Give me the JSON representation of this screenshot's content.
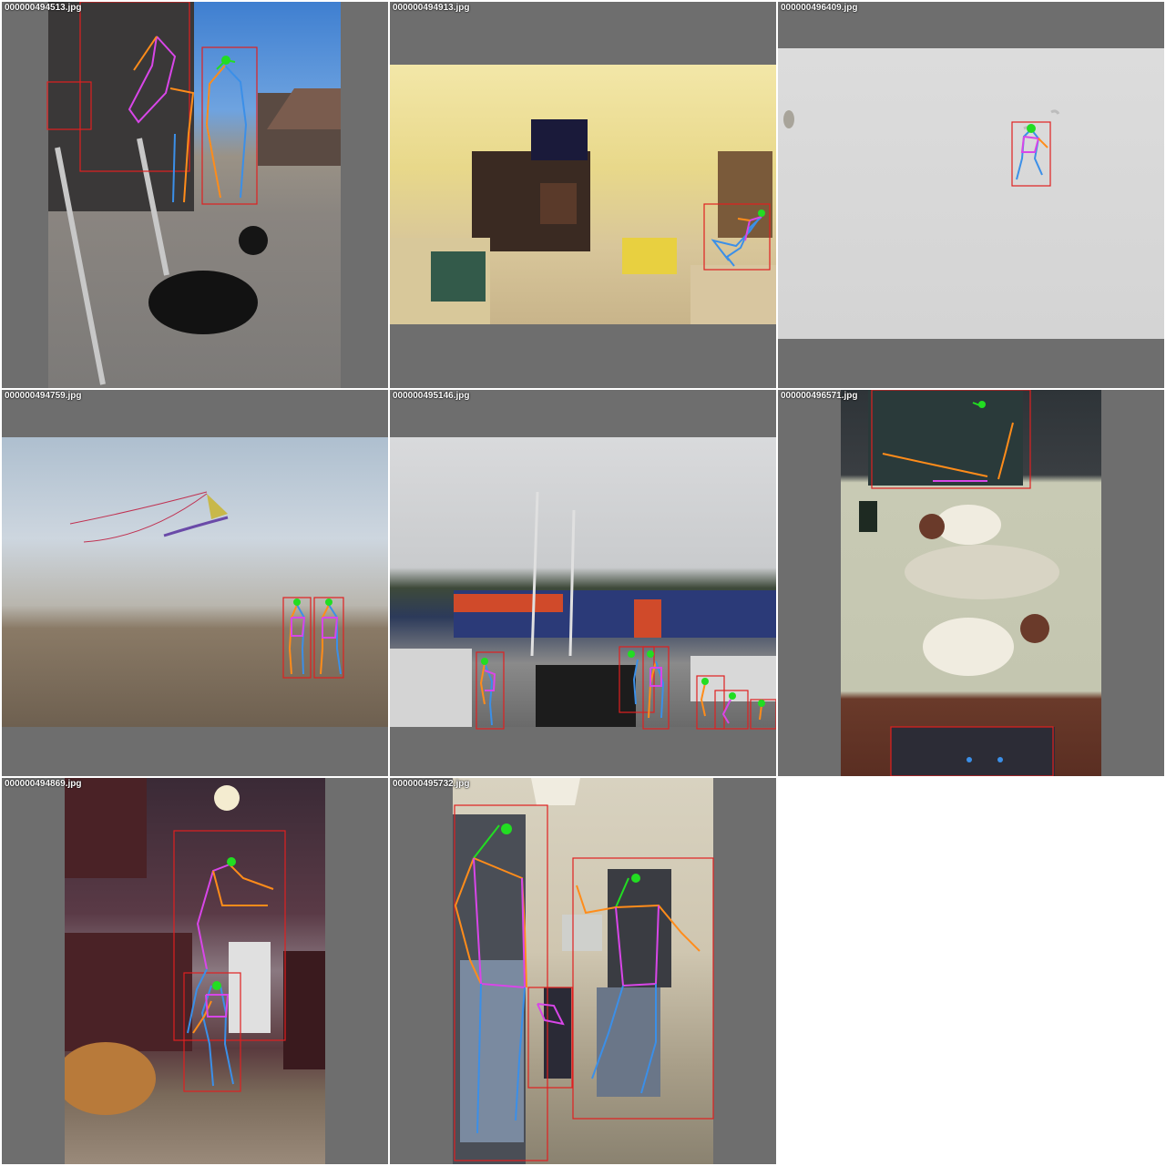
{
  "grid": {
    "tiles": [
      {
        "filename": "000000494513.jpg"
      },
      {
        "filename": "000000494913.jpg"
      },
      {
        "filename": "000000496409.jpg"
      },
      {
        "filename": "000000494759.jpg"
      },
      {
        "filename": "000000495146.jpg"
      },
      {
        "filename": "000000496571.jpg"
      },
      {
        "filename": "000000494869.jpg"
      },
      {
        "filename": "000000495732.jpg"
      }
    ]
  },
  "colors": {
    "tile_background": "#6e6e6e",
    "bbox": "#e02020",
    "head": "#22dd22",
    "left_limbs": "#ff8c1a",
    "right_limbs": "#3b8fe8",
    "torso": "#d846e8"
  },
  "overlay_legend": [
    "bounding-box",
    "keypoint-skeleton"
  ]
}
